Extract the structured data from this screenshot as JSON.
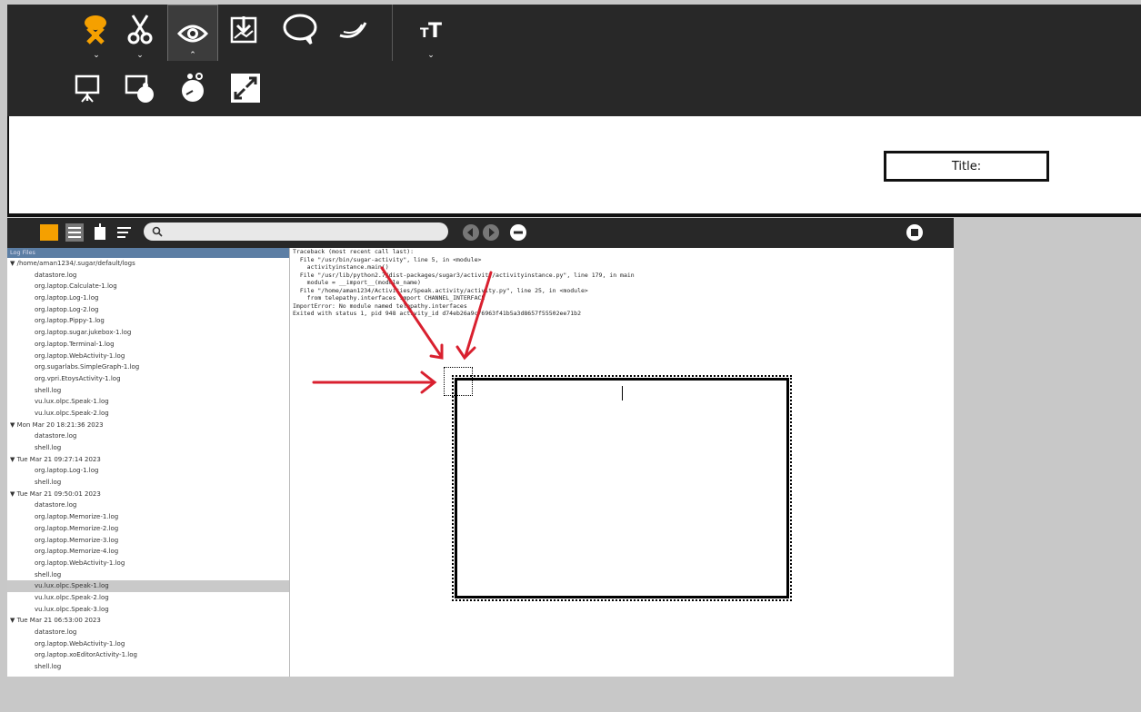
{
  "slide": {
    "title_label": "Title:"
  },
  "logviewer": {
    "search_placeholder": "",
    "panel_header": "Log Files",
    "tree": [
      {
        "label": "▼ /home/aman1234/.sugar/default/logs",
        "level": 0,
        "selected": false
      },
      {
        "label": "datastore.log",
        "level": 1,
        "selected": false
      },
      {
        "label": "org.laptop.Calculate-1.log",
        "level": 1,
        "selected": false
      },
      {
        "label": "org.laptop.Log-1.log",
        "level": 1,
        "selected": false
      },
      {
        "label": "org.laptop.Log-2.log",
        "level": 1,
        "selected": false
      },
      {
        "label": "org.laptop.Pippy-1.log",
        "level": 1,
        "selected": false
      },
      {
        "label": "org.laptop.sugar.jukebox-1.log",
        "level": 1,
        "selected": false
      },
      {
        "label": "org.laptop.Terminal-1.log",
        "level": 1,
        "selected": false
      },
      {
        "label": "org.laptop.WebActivity-1.log",
        "level": 1,
        "selected": false
      },
      {
        "label": "org.sugarlabs.SimpleGraph-1.log",
        "level": 1,
        "selected": false
      },
      {
        "label": "org.vpri.EtoysActivity-1.log",
        "level": 1,
        "selected": false
      },
      {
        "label": "shell.log",
        "level": 1,
        "selected": false
      },
      {
        "label": "vu.lux.olpc.Speak-1.log",
        "level": 1,
        "selected": false
      },
      {
        "label": "vu.lux.olpc.Speak-2.log",
        "level": 1,
        "selected": false
      },
      {
        "label": "▼ Mon Mar 20 18:21:36 2023",
        "level": 0,
        "selected": false
      },
      {
        "label": "datastore.log",
        "level": 1,
        "selected": false
      },
      {
        "label": "shell.log",
        "level": 1,
        "selected": false
      },
      {
        "label": "▼ Tue Mar 21 09:27:14 2023",
        "level": 0,
        "selected": false
      },
      {
        "label": "org.laptop.Log-1.log",
        "level": 1,
        "selected": false
      },
      {
        "label": "shell.log",
        "level": 1,
        "selected": false
      },
      {
        "label": "▼ Tue Mar 21 09:50:01 2023",
        "level": 0,
        "selected": false
      },
      {
        "label": "datastore.log",
        "level": 1,
        "selected": false
      },
      {
        "label": "org.laptop.Memorize-1.log",
        "level": 1,
        "selected": false
      },
      {
        "label": "org.laptop.Memorize-2.log",
        "level": 1,
        "selected": false
      },
      {
        "label": "org.laptop.Memorize-3.log",
        "level": 1,
        "selected": false
      },
      {
        "label": "org.laptop.Memorize-4.log",
        "level": 1,
        "selected": false
      },
      {
        "label": "org.laptop.WebActivity-1.log",
        "level": 1,
        "selected": false
      },
      {
        "label": "shell.log",
        "level": 1,
        "selected": false
      },
      {
        "label": "vu.lux.olpc.Speak-1.log",
        "level": 1,
        "selected": true
      },
      {
        "label": "vu.lux.olpc.Speak-2.log",
        "level": 1,
        "selected": false
      },
      {
        "label": "vu.lux.olpc.Speak-3.log",
        "level": 1,
        "selected": false
      },
      {
        "label": "▼ Tue Mar 21 06:53:00 2023",
        "level": 0,
        "selected": false
      },
      {
        "label": "datastore.log",
        "level": 1,
        "selected": false
      },
      {
        "label": "org.laptop.WebActivity-1.log",
        "level": 1,
        "selected": false
      },
      {
        "label": "org.laptop.xoEditorActivity-1.log",
        "level": 1,
        "selected": false
      },
      {
        "label": "shell.log",
        "level": 1,
        "selected": false
      }
    ],
    "log_lines": [
      "Traceback (most recent call last):",
      "  File \"/usr/bin/sugar-activity\", line 5, in <module>",
      "    activityinstance.main()",
      "  File \"/usr/lib/python2.7/dist-packages/sugar3/activity/activityinstance.py\", line 179, in main",
      "    module = __import__(module_name)",
      "  File \"/home/aman1234/Activities/Speak.activity/activity.py\", line 25, in <module>",
      "    from telepathy.interfaces import CHANNEL_INTERFACE",
      "ImportError: No module named telepathy.interfaces",
      "Exited with status 1, pid 948 activity_id d74eb26a9c76963f41b5a3d8657f55502ee71b2"
    ]
  },
  "colors": {
    "toolbar": "#282828",
    "annotation_arrow": "#d9202f",
    "sugar_orange": "#f5a000"
  }
}
